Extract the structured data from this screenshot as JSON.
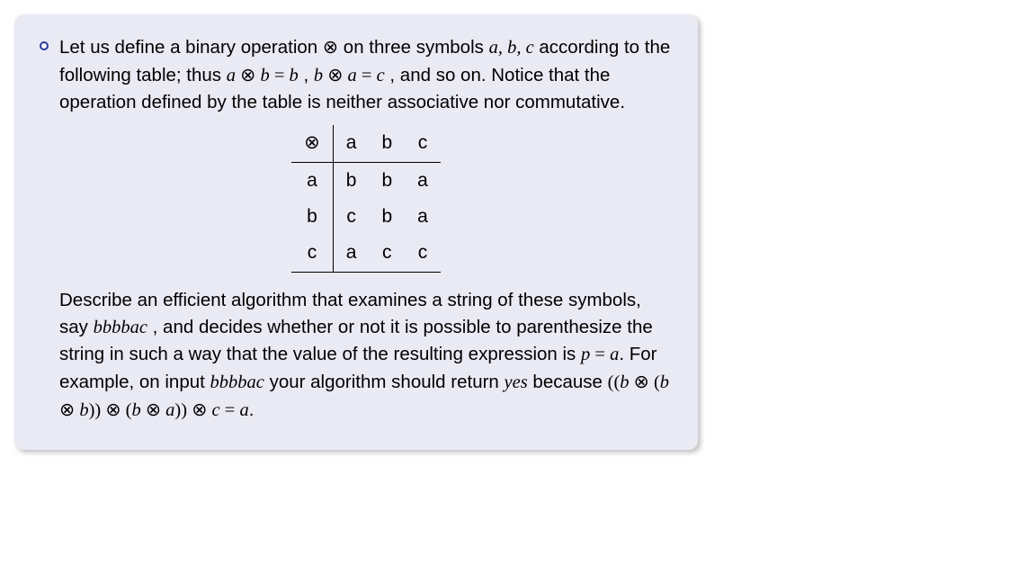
{
  "paragraph1": {
    "p1a": "Let us define a binary operation ",
    "p1_op1": "⊗",
    "p1b": " on three symbols ",
    "p1_sym1": "a",
    "p1_comma1": ", ",
    "p1_sym2": "b",
    "p1_comma2": ", ",
    "p1_sym3": "c",
    "p1c": " according to the following table; thus ",
    "p1_ex1": "a ",
    "p1_op2": "⊗",
    "p1_ex1b": " b ",
    "p1_eq1": "= ",
    "p1_ex1c": "b",
    "p1_comma3": " , ",
    "p1_ex2a": "b ",
    "p1_op3": "⊗",
    "p1_ex2b": " a ",
    "p1_eq2": "= ",
    "p1_ex2c": "c",
    "p1d": " , and so on. Notice that the operation defined by the table is neither associative nor commutative."
  },
  "table": {
    "corner": "⊗",
    "col_heads": [
      "a",
      "b",
      "c"
    ],
    "row_heads": [
      "a",
      "b",
      "c"
    ],
    "cells": [
      [
        "b",
        "b",
        "a"
      ],
      [
        "c",
        "b",
        "a"
      ],
      [
        "a",
        "c",
        "c"
      ]
    ]
  },
  "paragraph2": {
    "p2a": "Describe an efficient algorithm that examines a string of these symbols, say ",
    "p2_ex": "bbbbac",
    "p2b": " , and decides whether or not it is possible to parenthesize the string in such a way that the value of the resulting expression is ",
    "p2_p": "p ",
    "p2_eq": "= ",
    "p2_a": " a",
    "p2c": ". For example, on input ",
    "p2_ex2": "bbbbac",
    "p2d": " your algorithm should return ",
    "p2_yes": "yes",
    "p2e": " because ",
    "p2_expr": {
      "t1": "((",
      "t2": "b ",
      "op1": "⊗",
      "t3": " (",
      "t4": "b ",
      "op2": "⊗",
      "t5": " b",
      "t6": ")) ",
      "op3": "⊗",
      "t7": " (",
      "t8": "b ",
      "op4": "⊗",
      "t9": " a",
      "t10": ")) ",
      "op5": "⊗",
      "t11": " c ",
      "eq": "= ",
      "t12": "a"
    },
    "p2f": "."
  }
}
